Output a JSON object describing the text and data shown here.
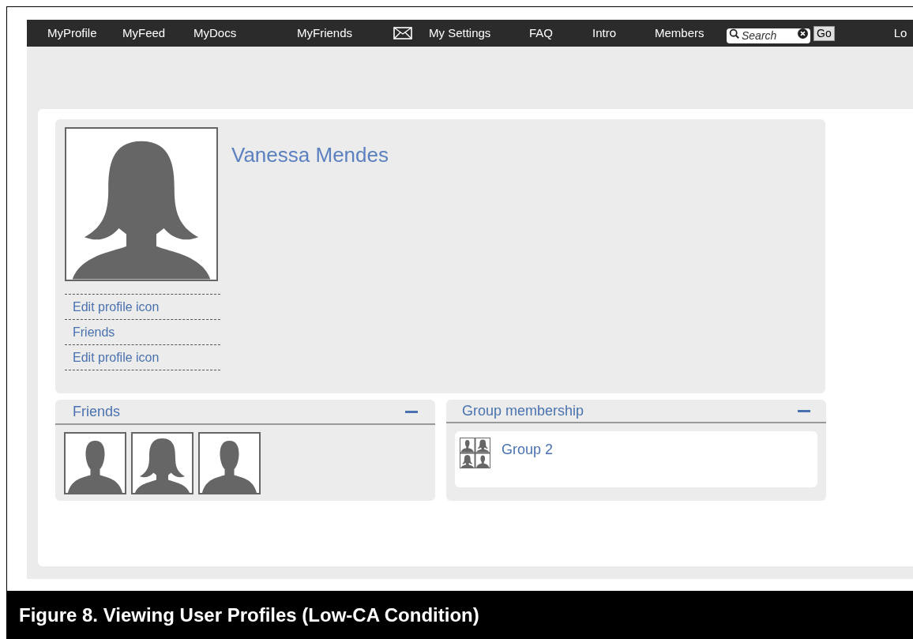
{
  "nav": {
    "items": [
      {
        "kind": "link",
        "label": "MyProfile"
      },
      {
        "kind": "link",
        "label": "MyFeed"
      },
      {
        "kind": "link",
        "label": "MyDocs"
      },
      {
        "kind": "link",
        "label": "MyFriends"
      },
      {
        "kind": "mail"
      },
      {
        "kind": "link",
        "label": "My Settings"
      },
      {
        "kind": "link",
        "label": "FAQ"
      },
      {
        "kind": "link",
        "label": "Intro"
      },
      {
        "kind": "link",
        "label": "Members"
      },
      {
        "kind": "search",
        "placeholder": "Search"
      },
      {
        "kind": "button",
        "label": "Go"
      },
      {
        "kind": "link",
        "label": "Lo"
      }
    ]
  },
  "profile": {
    "name": "Vanessa Mendes",
    "photo": {
      "kind": "female"
    },
    "links": [
      "Edit profile icon",
      "Friends",
      "Edit profile icon"
    ]
  },
  "friends": {
    "title": "Friends",
    "members": [
      {
        "kind": "male"
      },
      {
        "kind": "female"
      },
      {
        "kind": "male"
      }
    ]
  },
  "groups": {
    "title": "Group membership",
    "items": [
      {
        "name": "Group 2"
      }
    ]
  },
  "caption": "Figure 8. Viewing User Profiles (Low-CA Condition)"
}
